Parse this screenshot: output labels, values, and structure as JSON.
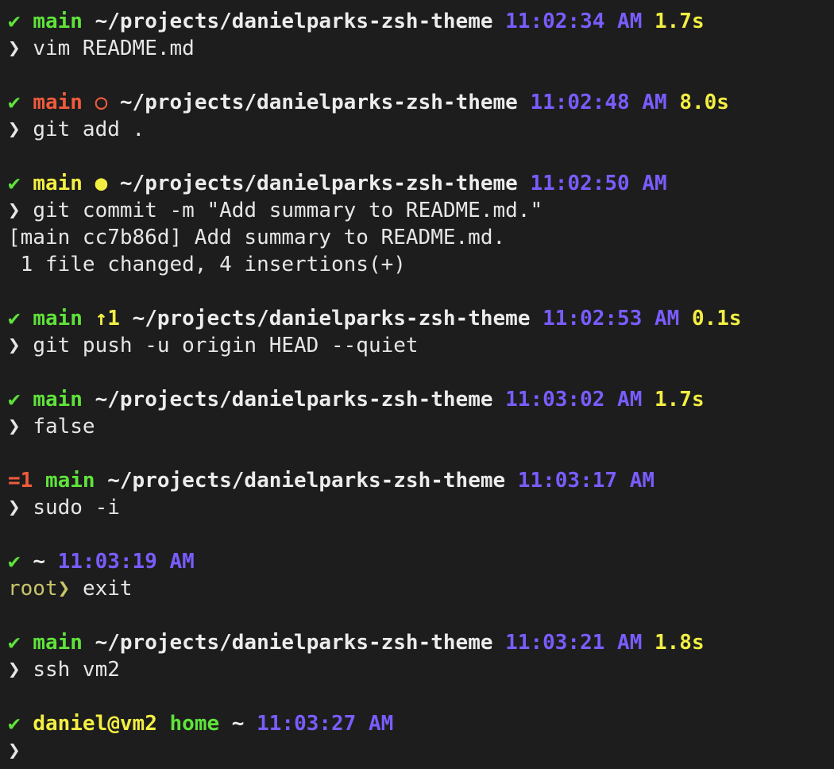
{
  "theme": {
    "background": "#1d1d1d",
    "foreground": "#e6e6e6",
    "green": "#5fe33a",
    "red": "#ef5b3c",
    "yellow": "#f2ef43",
    "purple": "#7a5cff",
    "olive": "#c9c56a"
  },
  "symbols": {
    "check": "✔",
    "prompt": "❯",
    "root_prompt": "root❯",
    "unstaged": "○",
    "staged": "●"
  },
  "lines": {
    "p1": {
      "branch": "main",
      "path": "~/projects/danielparks-zsh-theme",
      "time": "11:02:34 AM",
      "duration": "1.7s"
    },
    "c1": {
      "command": "vim README.md"
    },
    "p2": {
      "branch": "main",
      "path": "~/projects/danielparks-zsh-theme",
      "time": "11:02:48 AM",
      "duration": "8.0s"
    },
    "c2": {
      "command": "git add ."
    },
    "p3": {
      "branch": "main",
      "path": "~/projects/danielparks-zsh-theme",
      "time": "11:02:50 AM"
    },
    "c3": {
      "command": "git commit -m \"Add summary to README.md.\""
    },
    "o3a": "[main cc7b86d] Add summary to README.md.",
    "o3b": " 1 file changed, 4 insertions(+)",
    "p4": {
      "branch": "main",
      "ahead": "↑1",
      "path": "~/projects/danielparks-zsh-theme",
      "time": "11:02:53 AM",
      "duration": "0.1s"
    },
    "c4": {
      "command": "git push -u origin HEAD --quiet"
    },
    "p5": {
      "branch": "main",
      "path": "~/projects/danielparks-zsh-theme",
      "time": "11:03:02 AM",
      "duration": "1.7s"
    },
    "c5": {
      "command": "false"
    },
    "p6": {
      "exit_status": "=1",
      "branch": "main",
      "path": "~/projects/danielparks-zsh-theme",
      "time": "11:03:17 AM"
    },
    "c6": {
      "command": "sudo -i"
    },
    "p7": {
      "path": "~",
      "time": "11:03:19 AM"
    },
    "c7": {
      "command": "exit"
    },
    "p8": {
      "branch": "main",
      "path": "~/projects/danielparks-zsh-theme",
      "time": "11:03:21 AM",
      "duration": "1.8s"
    },
    "c8": {
      "command": "ssh vm2"
    },
    "p9": {
      "userhost": "daniel@vm2",
      "branch": "home",
      "path": "~",
      "time": "11:03:27 AM"
    }
  }
}
